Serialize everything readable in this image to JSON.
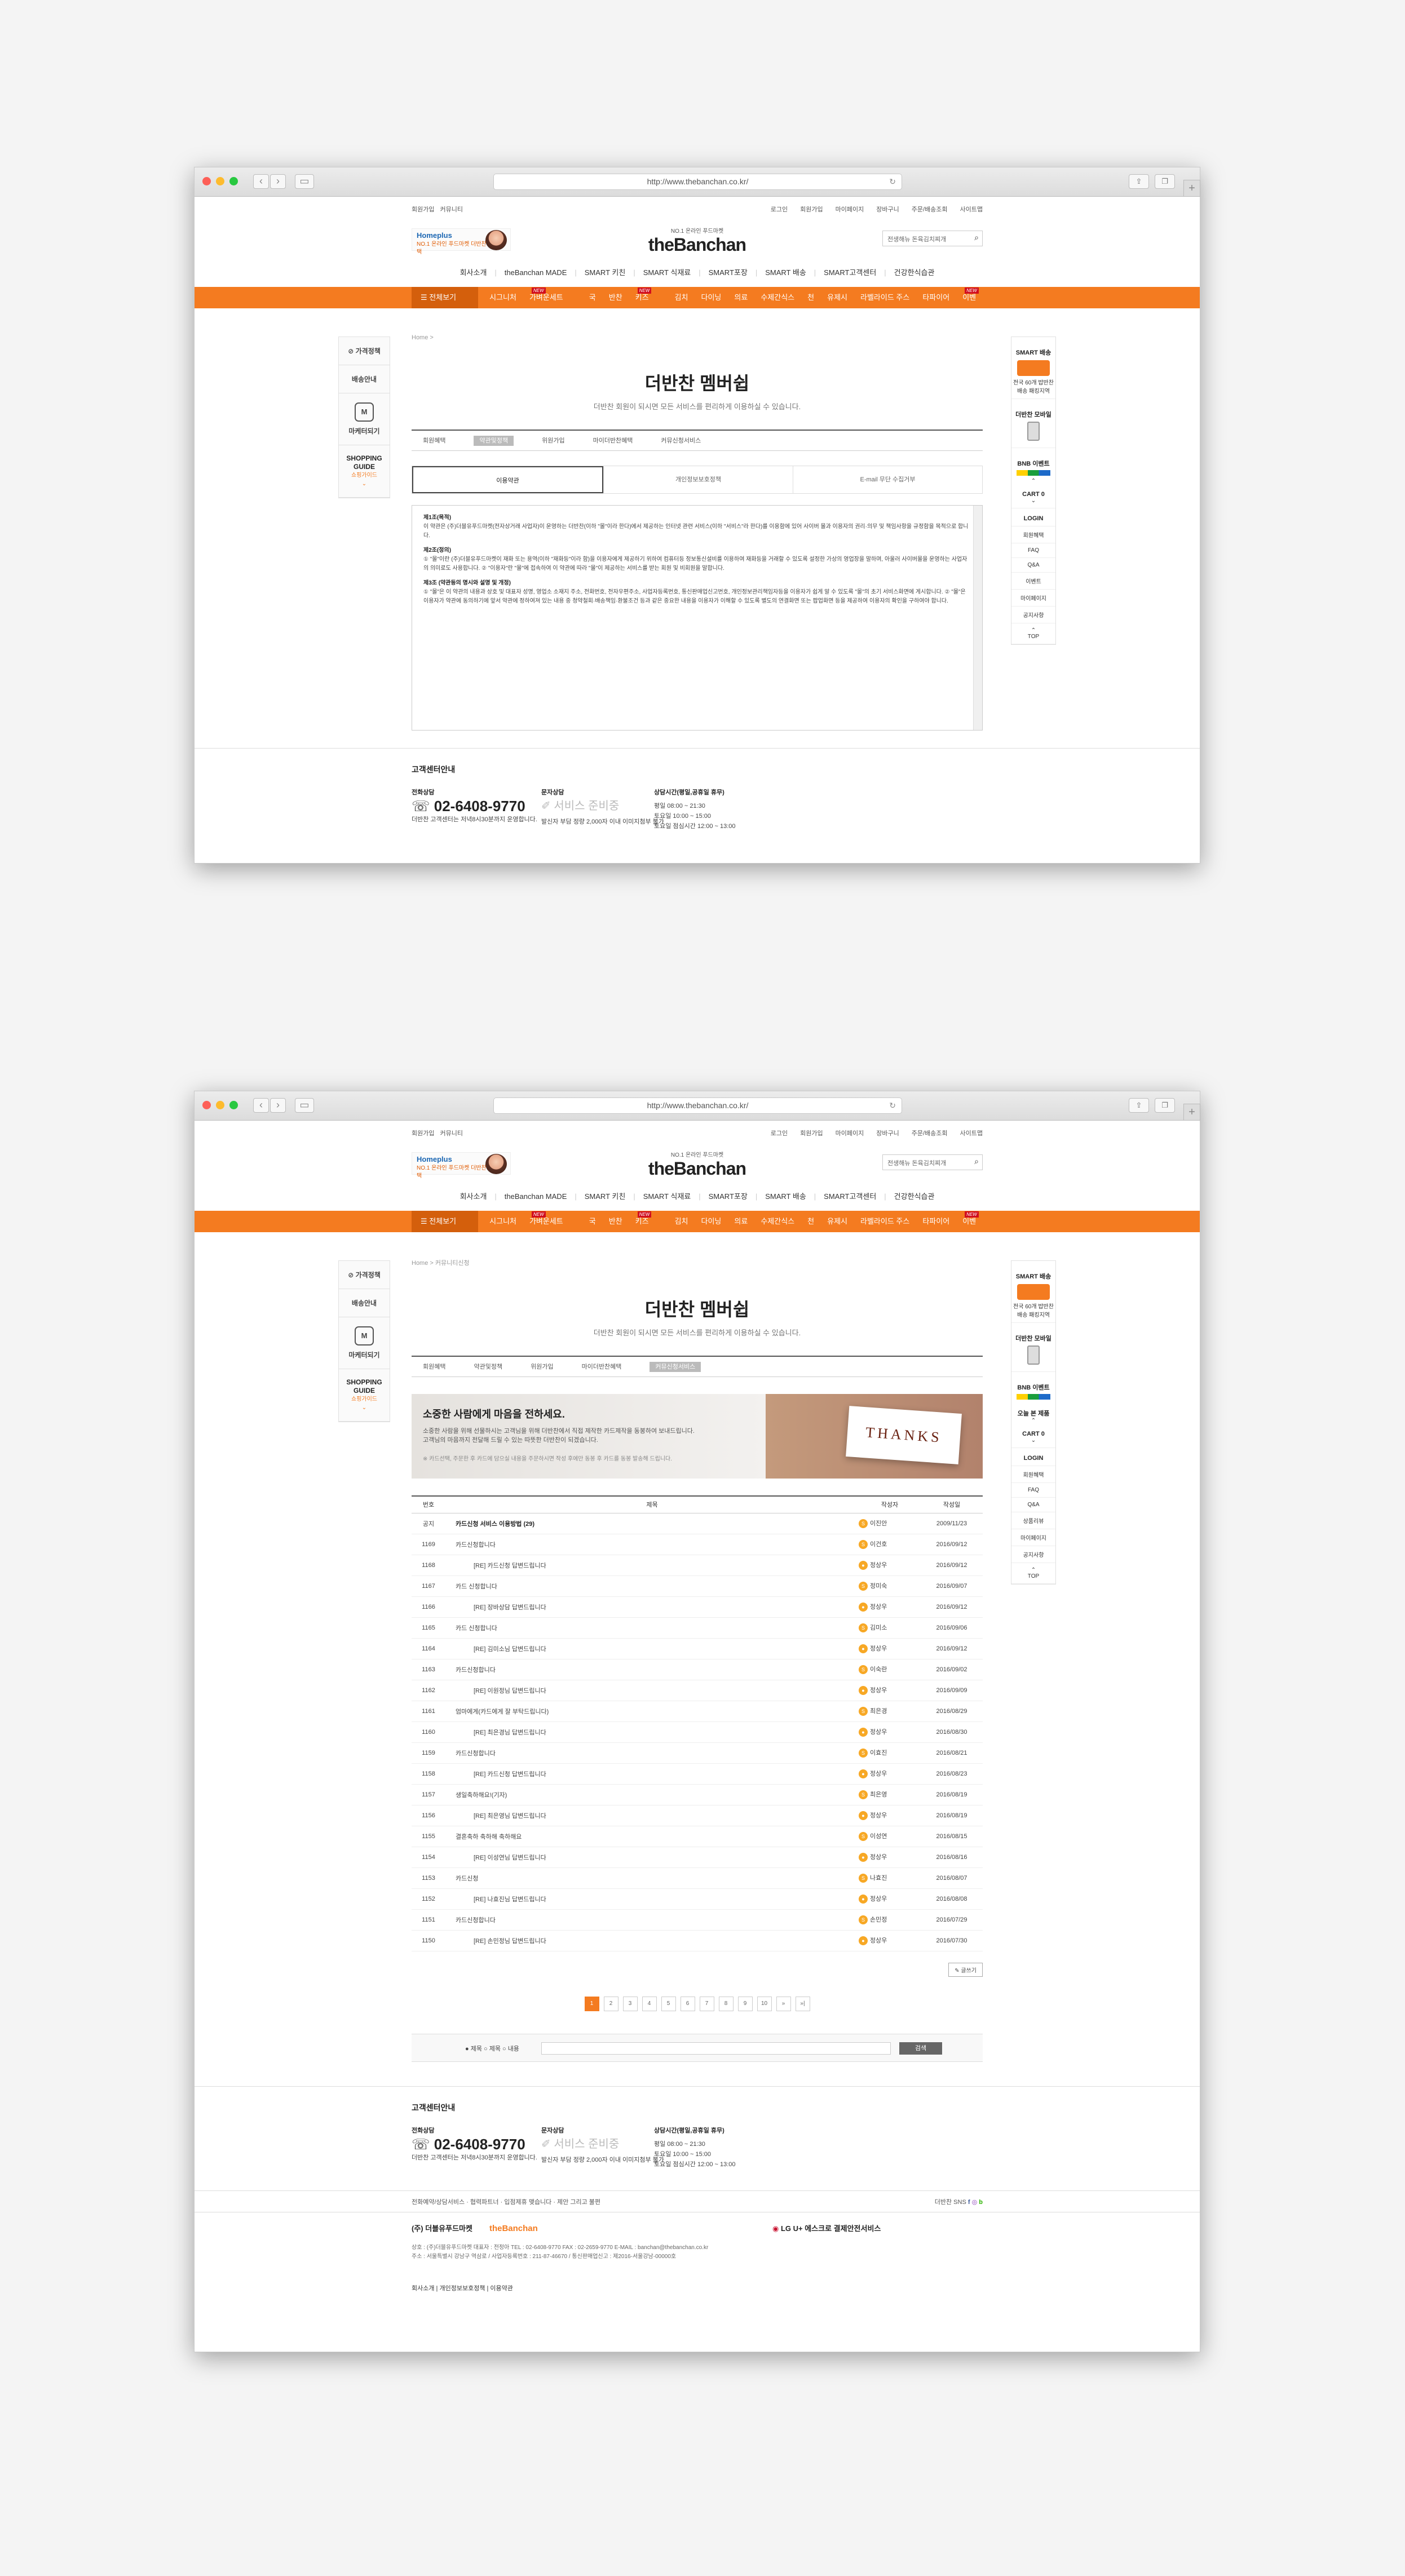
{
  "browser": {
    "url": "http://www.thebanchan.co.kr/"
  },
  "util_left": [
    "회원가입",
    "커뮤니티"
  ],
  "util_right": [
    "로그인",
    "회원가입",
    "마이페이지",
    "장바구니",
    "주문/배송조회",
    "사이트맵"
  ],
  "promo": {
    "brand": "Homeplus",
    "text": "NO.1 온라인 푸드마켓 더반찬 특별혜택"
  },
  "logo": {
    "small": "NO.1 온라인 푸드마켓",
    "main": "theBanchan"
  },
  "search": {
    "placeholder": "전생해뉴 돈육김치찌개"
  },
  "gnb": [
    "회사소개",
    "theBanchan MADE",
    "SMART 키친",
    "SMART 식재료",
    "SMART포장",
    "SMART 배송",
    "SMART고객센터",
    "건강한식습관"
  ],
  "categories": [
    "전체보기",
    "시그니처",
    "가벼운세트",
    "국",
    "반찬",
    "키즈",
    "김치",
    "다이닝",
    "의료",
    "수제간식스",
    "천",
    "유제시",
    "라벨라이드 주스",
    "타파이어",
    "이벤트"
  ],
  "left_side": {
    "price": "가격정책",
    "delivery": "배송안내",
    "market": "마케터되기",
    "guide": "SHOPPING GUIDE",
    "guide_sub": "쇼핑가이드"
  },
  "right_side": {
    "delivery": "SMART 배송",
    "delivery_sub": "전국 60개 밥반찬배송 패킹지역",
    "mobile": "더반찬 모바일",
    "app": "BNB 이벤트",
    "cart": "CART",
    "login": "LOGIN",
    "menu": [
      "회원혜택",
      "FAQ",
      "Q&A",
      "이벤트",
      "상품리뷰",
      "공지사항",
      "마이페이지",
      "개인정보"
    ],
    "today": "오늘 본 제품",
    "top": "TOP"
  },
  "page1": {
    "bc": "Home >",
    "title": "더반찬 멤버쉽",
    "sub": "더반찬 회원이 되시면 모든 서비스를 편리하게 이용하실 수 있습니다.",
    "tabs": [
      "회원혜택",
      "약관및정책",
      "위원가입",
      "마이더반찬혜택",
      "커뮤신청서비스"
    ],
    "agree": [
      "이용약관",
      "개인정보보호정책",
      "E-mail 무단 수집거부"
    ],
    "terms": [
      {
        "h": "제1조(목적)",
        "t": "이 약관은 (주)더블유푸드마켓(전자상거래 사업자)이 운영하는 더반찬(이하 \"몰\"이라 한다)에서 제공하는 인터넷 관련 서비스(이하 \"서비스\"라 한다)를 이용함에 있어 사이버 몰과 이용자의 권리·의무 및 책임사항을 규정함을 목적으로 합니다."
      },
      {
        "h": "제2조(정의)",
        "t": "① \"몰\"이란 (주)더블유푸드마켓이 재화 또는 용역(이하 \"재화등\"이라 함)을 이용자에게 제공하기 위하여 컴퓨터등 정보통신설비를 이용하여 재화등을 거래할 수 있도록 설정한 가상의 영업장을 말하며, 아울러 사이버몰을 운영하는 사업자의 의미로도 사용합니다. ② \"이용자\"란 \"몰\"에 접속하여 이 약관에 따라 \"몰\"이 제공하는 서비스를 받는 회원 및 비회원을 말합니다."
      },
      {
        "h": "제3조 (약관등의 명시와 설명 및 개정)",
        "t": "① \"몰\"은 이 약관의 내용과 상호 및 대표자 성명, 영업소 소재지 주소, 전화번호, 전자우편주소, 사업자등록번호, 통신판매업신고번호, 개인정보관리책임자등을 이용자가 쉽게 알 수 있도록 \"몰\"의 초기 서비스화면에 게시합니다. ② \"몰\"은 이용자가 약관에 동의하기에 앞서 약관에 정하여져 있는 내용 중 청약철회·배송책임·환불조건 등과 같은 중요한 내용을 이용자가 이해할 수 있도록 별도의 연결화면 또는 팝업화면 등을 제공하여 이용자의 확인을 구하여야 합니다."
      }
    ]
  },
  "page2": {
    "bc": "Home > 커뮤니티신청",
    "title": "더반찬 멤버쉽",
    "sub": "더반찬 회원이 되시면 모든 서비스를 편리하게 이용하실 수 있습니다.",
    "tabs": [
      "회원혜택",
      "약관및정책",
      "위원가입",
      "마이더반찬혜택",
      "커뮤신청서비스"
    ],
    "banner": {
      "h": "소중한 사람에게 마음을 전하세요.",
      "p1": "소중한 사람을 위해 선물하시는 고객님을 위해 더반찬에서 직접 제작한 카드제작을 동봉하여 보내드립니다.",
      "p2": "고객님의 마음까지 전달해 드릴 수 있는 따뜻한 더반찬이 되겠습니다.",
      "note": "※ 카드선택, 주문한 후 카드에 담으실 내용을 주문하시면 작성 후에만 동봉 후 카드를 동봉 발송해 드립니다.",
      "thanks": "THANKS"
    },
    "cols": [
      "번호",
      "제목",
      "작성자",
      "작성일"
    ],
    "rows": [
      [
        "공지",
        "카드신청 서비스 이용방법 (29)",
        "이진안",
        "2009/11/23"
      ],
      [
        "1169",
        "카드신청합니다",
        "이건호",
        "2016/09/12"
      ],
      [
        "1168",
        "[RE] 카드신청 답변드립니다",
        "정상우",
        "2016/09/12"
      ],
      [
        "1167",
        "카드 신청합니다",
        "정미숙",
        "2016/09/07"
      ],
      [
        "1166",
        "[RE] 장바상담 답변드립니다",
        "정상우",
        "2016/09/12"
      ],
      [
        "1165",
        "카드 신청합니다",
        "김미소",
        "2016/09/06"
      ],
      [
        "1164",
        "[RE] 김미소님 답변드립니다",
        "정상우",
        "2016/09/12"
      ],
      [
        "1163",
        "카드신청합니다",
        "이숙란",
        "2016/09/02"
      ],
      [
        "1162",
        "[RE] 이원정님 답변드립니다",
        "정상우",
        "2016/09/09"
      ],
      [
        "1161",
        "엄마에게(카드에게 잘 부탁드립니다)",
        "최은경",
        "2016/08/29"
      ],
      [
        "1160",
        "[RE] 최은경님 답변드립니다",
        "정상우",
        "2016/08/30"
      ],
      [
        "1159",
        "카드신청합니다",
        "이효진",
        "2016/08/21"
      ],
      [
        "1158",
        "[RE] 카드신청 답변드립니다",
        "정상우",
        "2016/08/23"
      ],
      [
        "1157",
        "생일축하해요!(기자)",
        "최은영",
        "2016/08/19"
      ],
      [
        "1156",
        "[RE] 최은영님 답변드립니다",
        "정상우",
        "2016/08/19"
      ],
      [
        "1155",
        "결혼축하 축하해 축하해요",
        "이성연",
        "2016/08/15"
      ],
      [
        "1154",
        "[RE] 이성연님 답변드립니다",
        "정상우",
        "2016/08/16"
      ],
      [
        "1153",
        "카드신청",
        "나효진",
        "2016/08/07"
      ],
      [
        "1152",
        "[RE] 나효진님 답변드립니다",
        "정상우",
        "2016/08/08"
      ],
      [
        "1151",
        "카드신청합니다",
        "손민정",
        "2016/07/29"
      ],
      [
        "1150",
        "[RE] 손민정님 답변드립니다",
        "정상우",
        "2016/07/30"
      ]
    ],
    "write": "글쓰기",
    "pages": [
      "1",
      "2",
      "3",
      "4",
      "5",
      "6",
      "7",
      "8",
      "9",
      "10",
      "»",
      "»|"
    ],
    "search_opts": "● 제목 ○ 제목 ○ 내용",
    "search_btn": "검색"
  },
  "footer": {
    "title": "고객센터안내",
    "phone_label": "전화상담",
    "phone": "02-6408-9770",
    "phone_note": "더반찬 고객센터는 저녁8시30분까지 운영합니다.",
    "chat_label": "문자상담",
    "chat": "서비스 준비중",
    "chat_note": "발신자 부담 정량 2,000자 이내 이미지첨부 불가",
    "hours_label": "상담시간(평일,공휴일 휴무)",
    "hours": [
      "평일 08:00 ~ 21:30",
      "토요일 10:00 ~ 15:00",
      "토요일 점심시간 12:00 ~ 13:00"
    ]
  },
  "footer2": {
    "links": "전화예약/상담서비스  ·  협력파트너  ·  입점제휴 맺습니다  ·  제안 그리고 불편",
    "sns": "더반찬 SNS",
    "corp": "(주) 더블유푸드마켓",
    "corp_brand": "theBanchan",
    "lgu": "LG U+ 에스크로 결제안전서비스",
    "addr": "상호 : (주)더블유푸드마켓 대표자 : 전정아 TEL : 02-6408-9770 FAX : 02-2659-9770 E-MAIL : banchan@thebanchan.co.kr",
    "addr2": "주소 : 서울특별시 강남구 역삼로 / 사업자등록번호 : 211-87-46670 / 통신판매업신고 : 제2016-서울강남-00000호",
    "bottom": [
      "회사소개",
      "개인정보보호정책",
      "이용약관"
    ]
  }
}
